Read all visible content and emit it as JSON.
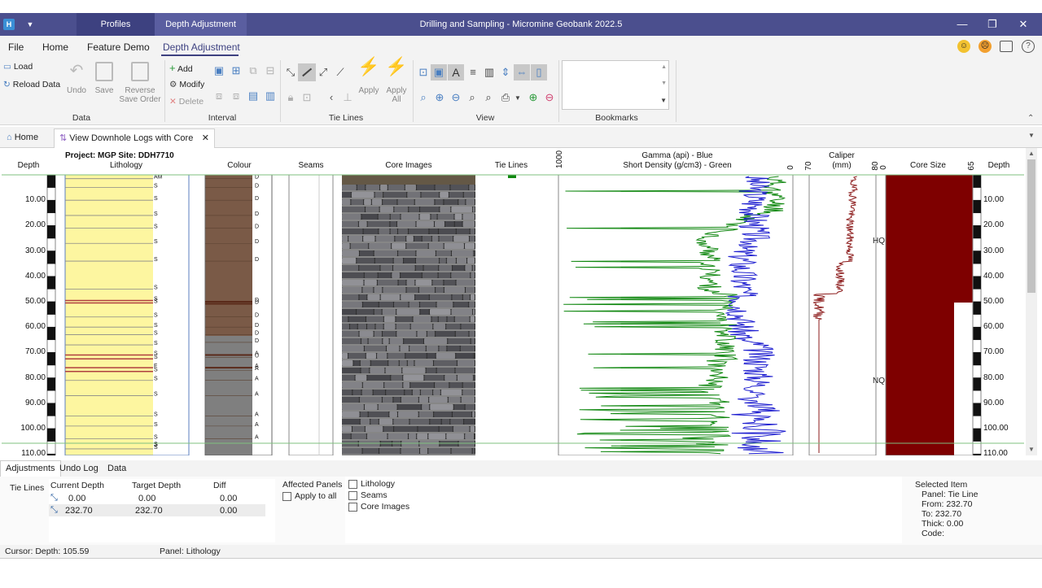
{
  "titlebar": {
    "tabs": [
      "Profiles",
      "Depth Adjustment"
    ],
    "title": "Drilling and Sampling - Micromine Geobank 2022.5"
  },
  "menu": [
    "File",
    "Home",
    "Feature Demo",
    "Depth Adjustment"
  ],
  "ribbon": {
    "data_group": {
      "load": "Load",
      "reload": "Reload Data",
      "undo": "Undo",
      "save": "Save",
      "reverse_save_order": "Reverse Save Order",
      "label": "Data"
    },
    "interval_group": {
      "add": "Add",
      "modify": "Modify",
      "delete": "Delete",
      "label": "Interval"
    },
    "tielines_group": {
      "apply": "Apply",
      "apply_all": "Apply All",
      "label": "Tie Lines"
    },
    "view_group": {
      "label": "View"
    },
    "bookmarks_group": {
      "label": "Bookmarks"
    }
  },
  "doc_tabs": [
    "Home",
    "View Downhole Logs with Core"
  ],
  "log": {
    "project_line": "Project: MGP   Site: DDH7710",
    "headers": {
      "depth_left": "Depth",
      "lithology": "Lithology",
      "colour": "Colour",
      "seams": "Seams",
      "core_images": "Core Images",
      "tie_lines": "Tie Lines",
      "gamma": "Gamma (api) - Blue",
      "density": "Short Density (g/cm3) - Green",
      "gamma_max": "1000",
      "gamma_min": "0",
      "caliper": "Caliper",
      "caliper_unit": "(mm)",
      "caliper_min": "70",
      "caliper_max": "80",
      "core_size": "Core Size",
      "core_min": "0",
      "core_max": "65",
      "depth_right": "Depth"
    },
    "depth_ticks": [
      "10.00",
      "20.00",
      "30.00",
      "40.00",
      "50.00",
      "60.00",
      "70.00",
      "80.00",
      "90.00",
      "100.00",
      "110.00"
    ],
    "core_size_labels": [
      "HQ",
      "NQ"
    ],
    "lith_codes": [
      "AM",
      "S",
      "S",
      "S",
      "S",
      "S",
      "S",
      "S",
      "S",
      "S",
      "S",
      "S",
      "S",
      "S",
      "S",
      "S",
      "F",
      "S",
      "S",
      "S",
      "S",
      "S",
      "S",
      "S",
      "S",
      "S",
      "S"
    ],
    "colour_codes": [
      "D",
      "D",
      "D",
      "D",
      "D",
      "D",
      "D",
      "D",
      "D",
      "D",
      "D",
      "D",
      "D",
      "A",
      "U",
      "A",
      "A",
      "A",
      "A",
      "A",
      "A",
      "A"
    ]
  },
  "bottom": {
    "tabs": [
      "Adjustments",
      "Undo Log",
      "Data"
    ],
    "tie_lines_label": "Tie Lines",
    "table": {
      "headers": [
        "Current Depth",
        "Target Depth",
        "Diff"
      ],
      "rows": [
        [
          "0.00",
          "0.00",
          "0.00"
        ],
        [
          "232.70",
          "232.70",
          "0.00"
        ]
      ]
    },
    "affected_panels": "Affected Panels",
    "apply_to_all": "Apply to all",
    "panels": [
      "Lithology",
      "Seams",
      "Core Images"
    ],
    "selected_item": {
      "title": "Selected Item",
      "lines": [
        "Panel: Tie Line",
        "From: 232.70",
        "To: 232.70",
        "Thick: 0.00",
        "Code:"
      ]
    }
  },
  "status": {
    "cursor": "Cursor: Depth: 105.59",
    "panel": "Panel: Lithology"
  },
  "colors": {
    "accent": "#4b4f8e",
    "lithology": "#fdf6a0",
    "colour_brown": "#7a5a47",
    "colour_grey": "#7f7f7f",
    "core_size": "#7e0000",
    "gamma": "#1f1fd0",
    "density": "#118811",
    "caliper": "#8b1a1a"
  }
}
